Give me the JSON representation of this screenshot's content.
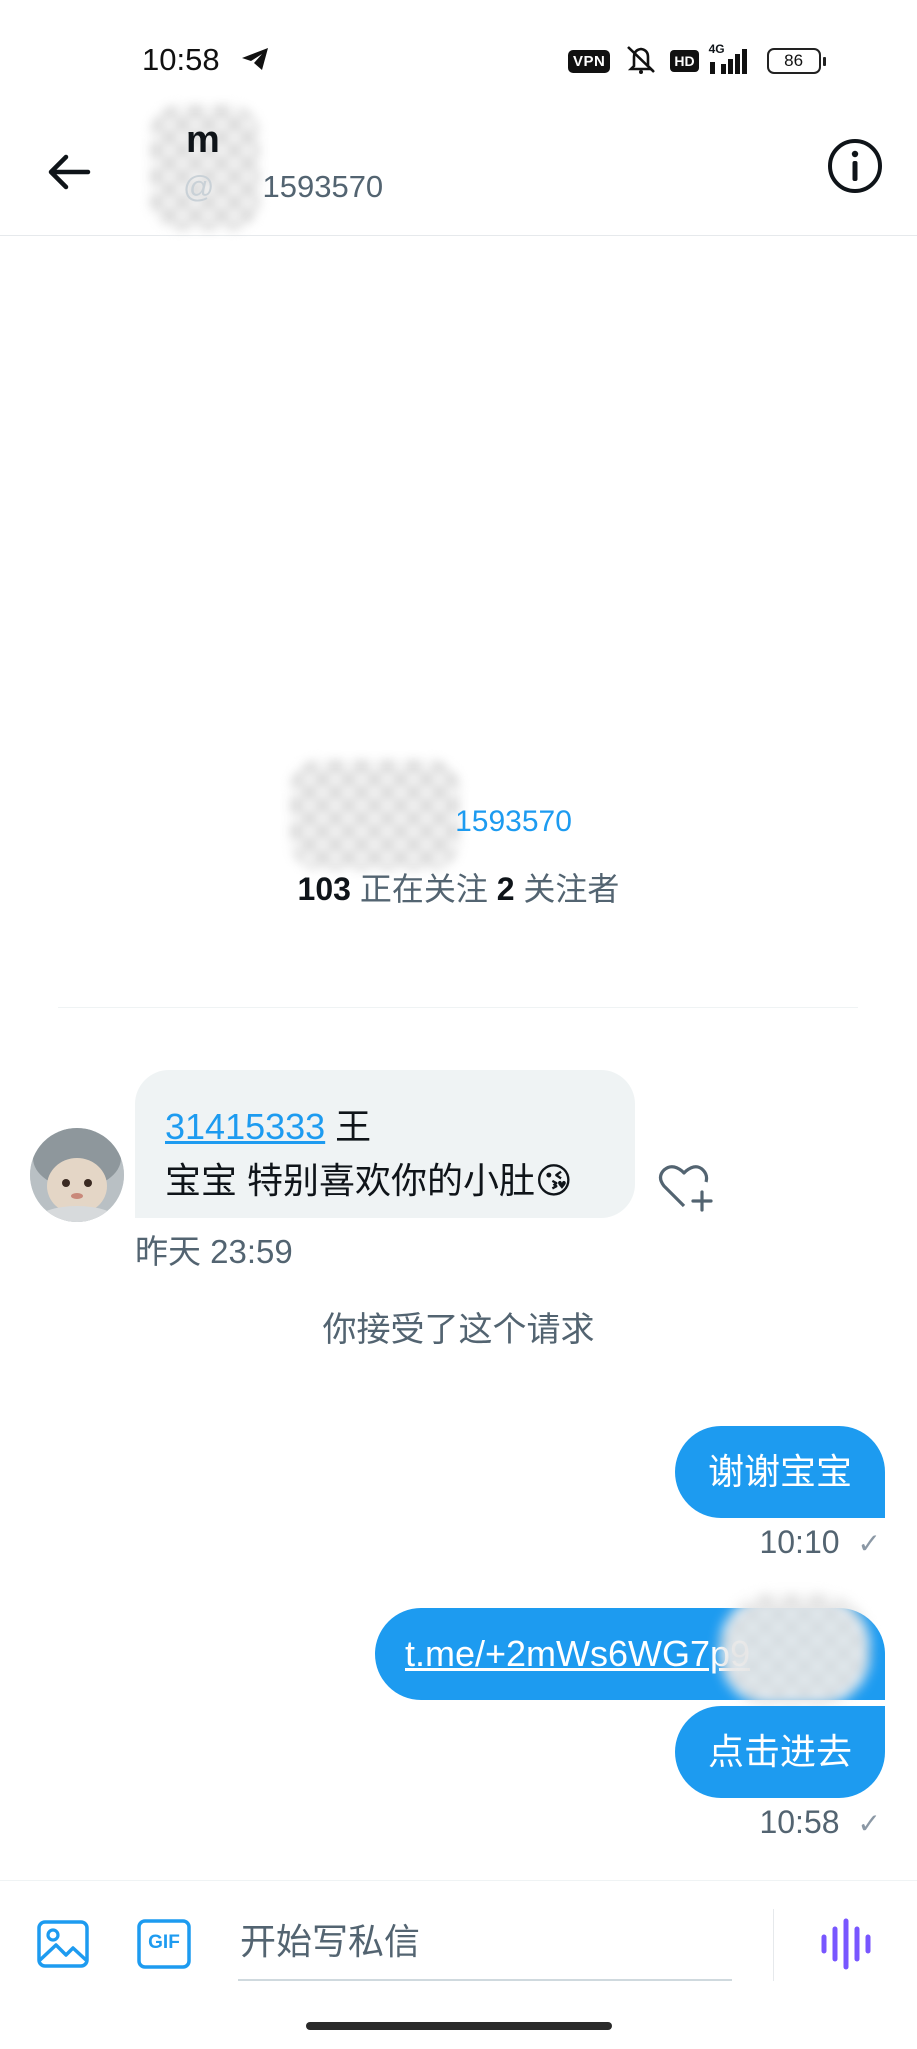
{
  "status_bar": {
    "time": "10:58",
    "vpn": "VPN",
    "hd": "HD",
    "network": "4G",
    "battery": "86"
  },
  "header": {
    "name_visible": "m",
    "handle_visible": "1593570",
    "back_icon": "arrow-left-icon",
    "info_icon": "info-circle-icon"
  },
  "profile": {
    "handle_visible": "1593570",
    "following_count": "103",
    "following_label": "正在关注",
    "followers_count": "2",
    "followers_label": "关注者"
  },
  "messages": {
    "incoming": {
      "link_text": "31415333",
      "after_link": " 王",
      "line2": "宝宝 特别喜欢你的小肚😘",
      "time": "昨天 23:59"
    },
    "request_note": "你接受了这个请求",
    "outgoing": [
      {
        "text": "谢谢宝宝",
        "time": "10:10"
      },
      {
        "text": "t.me/+2mWs6WG7p9"
      },
      {
        "text": "点击进去",
        "time": "10:58"
      }
    ]
  },
  "composer": {
    "placeholder": "开始写私信",
    "gif_label": "GIF"
  },
  "colors": {
    "accent": "#1d9bf0",
    "text_primary": "#0f1419",
    "text_secondary": "#536471",
    "incoming_bubble": "#eff3f4",
    "voice_icon": "#7856ff"
  }
}
